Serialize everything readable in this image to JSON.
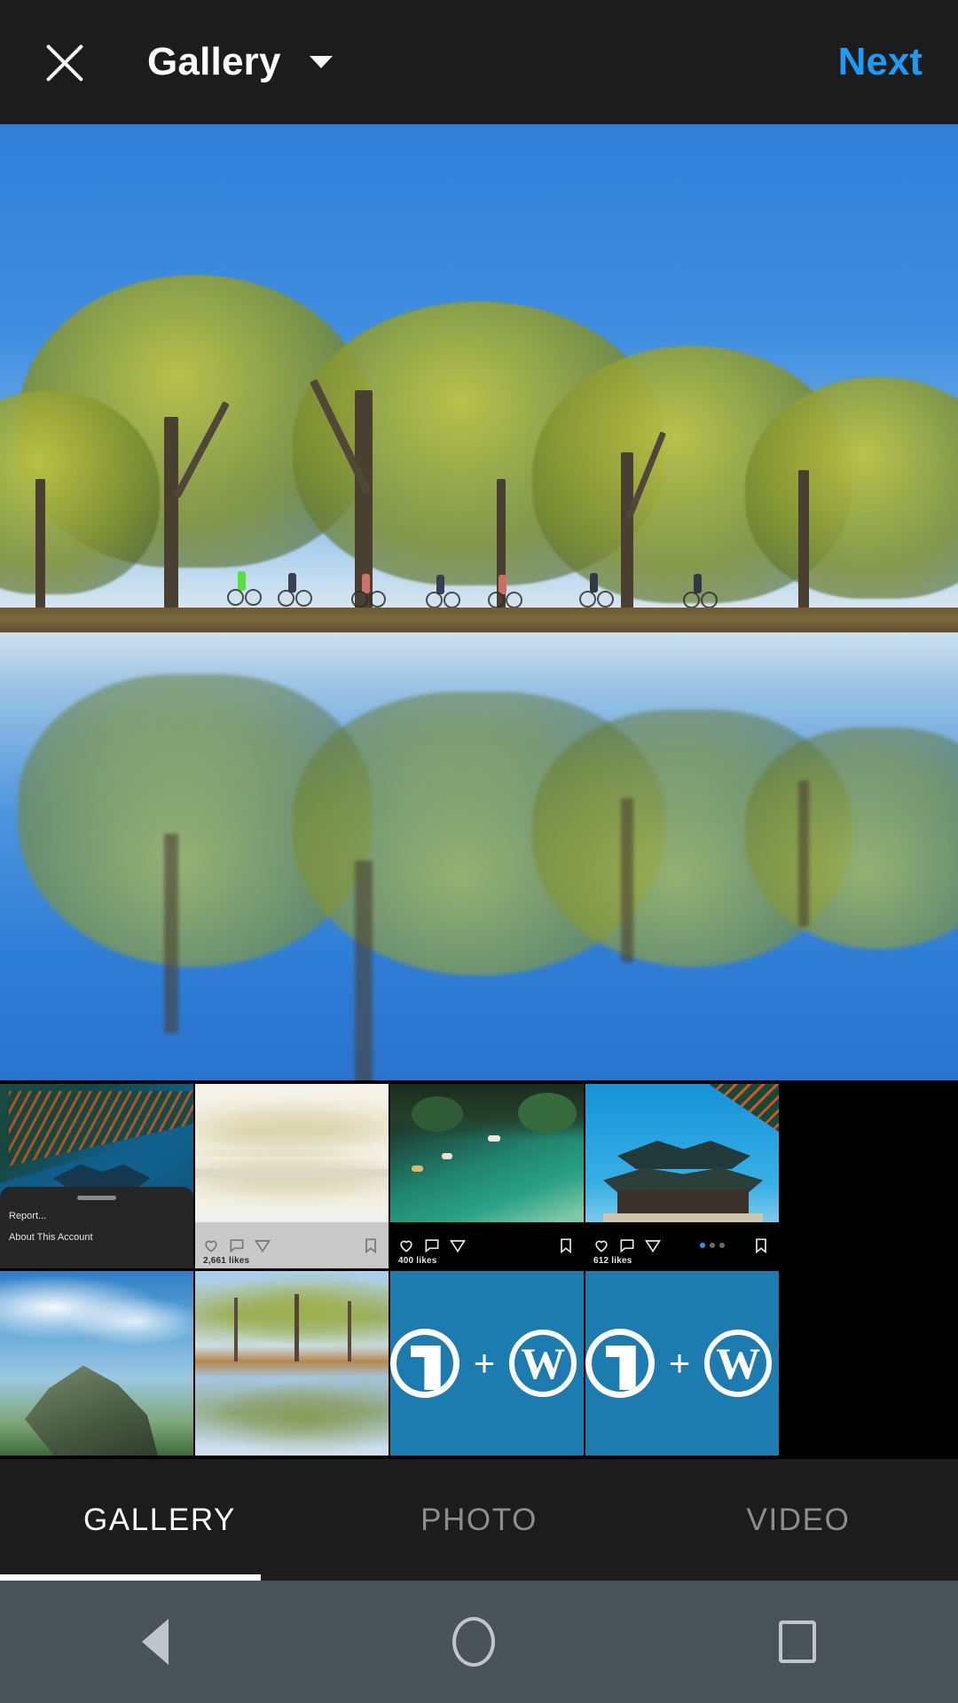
{
  "header": {
    "close_icon": "close-icon",
    "title": "Gallery",
    "dropdown_icon": "chevron-down-icon",
    "next_label": "Next",
    "next_color": "#1d9bf6",
    "background": "#1c1c1c"
  },
  "preview": {
    "description": "Row of tall trees with cyclists riding beneath, mirrored in still water",
    "controls": [
      {
        "name": "expand-crop-button",
        "icon": "expand-icon"
      },
      {
        "name": "boomerang-button",
        "icon": "infinity-icon",
        "glyph": "∞"
      },
      {
        "name": "layout-button",
        "icon": "layout-split-icon"
      },
      {
        "name": "multi-select-button",
        "icon": "stacked-squares-icon"
      }
    ]
  },
  "gallery": {
    "thumbnails": [
      {
        "name": "thumbnail-1",
        "kind": "screenshot-context-menu",
        "menu_items": [
          "Report...",
          "About This Account"
        ],
        "scene": "temple-eaves-blue-sky"
      },
      {
        "name": "thumbnail-2",
        "kind": "instagram-post-light",
        "likes": "2,661 likes",
        "scene": "pale-tree-reflection"
      },
      {
        "name": "thumbnail-3",
        "kind": "instagram-post-dark",
        "likes": "400 likes",
        "scene": "green-lagoon-boats"
      },
      {
        "name": "thumbnail-4",
        "kind": "instagram-post-carousel",
        "likes": "612 likes",
        "scene": "korean-palace",
        "carousel_dots": 3,
        "carousel_active": 1
      },
      {
        "name": "thumbnail-5",
        "kind": "photo",
        "scene": "rocky-peak-clouds"
      },
      {
        "name": "thumbnail-6",
        "kind": "photo",
        "scene": "tree-line-reflection"
      },
      {
        "name": "thumbnail-7",
        "kind": "wordpress-tile",
        "plus": "+",
        "wp_letter": "W"
      },
      {
        "name": "thumbnail-8",
        "kind": "wordpress-tile",
        "plus": "+",
        "wp_letter": "W"
      }
    ]
  },
  "tabs": {
    "items": [
      {
        "label": "GALLERY",
        "active": true
      },
      {
        "label": "PHOTO",
        "active": false
      },
      {
        "label": "VIDEO",
        "active": false
      }
    ]
  },
  "navbar": {
    "back_icon": "back-triangle-icon",
    "home_icon": "home-circle-icon",
    "recents_icon": "recents-square-icon",
    "background": "#4a5357"
  }
}
